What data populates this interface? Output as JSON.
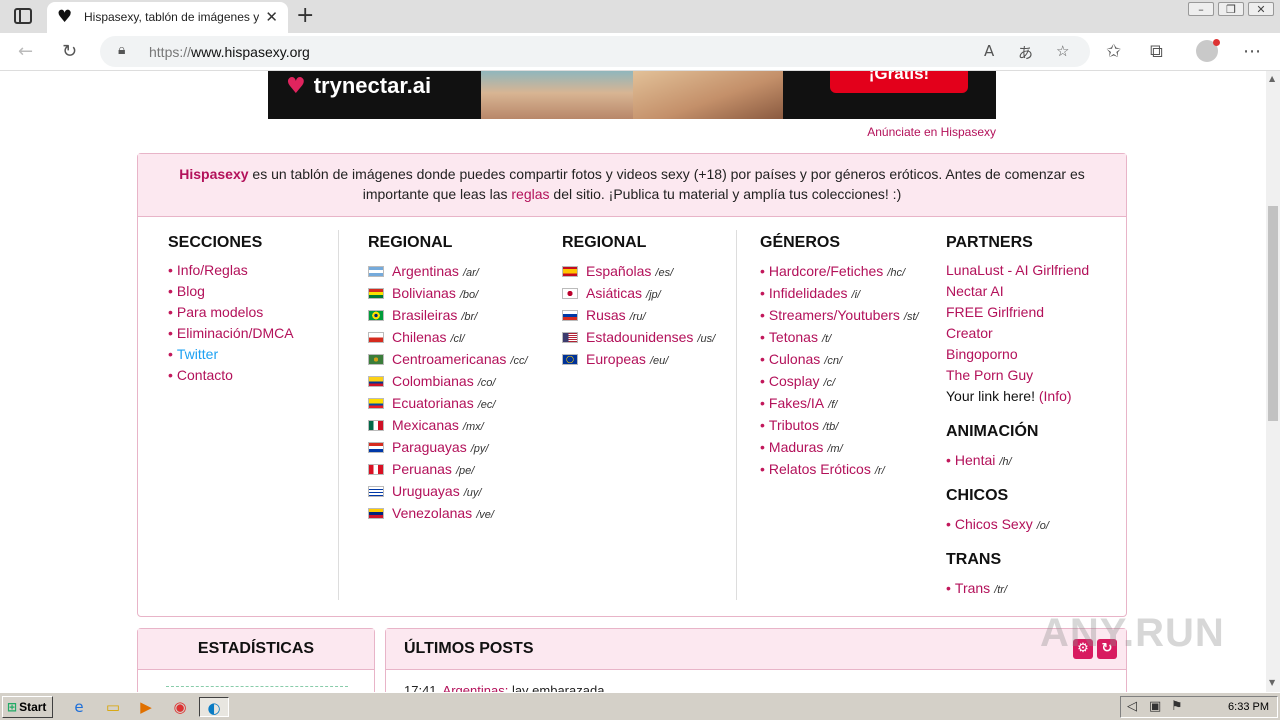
{
  "browser": {
    "tab_title": "Hispasexy, tablón de imágenes y",
    "url_scheme": "https://",
    "url_host": "www.hispasexy.org",
    "icons": [
      "tab-actions-icon",
      "heart-favicon-icon",
      "close-icon",
      "plus-icon",
      "back-icon",
      "refresh-icon",
      "lock-icon",
      "read-aloud-icon",
      "translate-icon",
      "add-favorite-icon",
      "favorites-icon",
      "collections-icon",
      "profile-icon",
      "more-icon"
    ],
    "window_buttons": [
      "–",
      "❐",
      "✕"
    ]
  },
  "ad": {
    "logo_text": "trynectar.ai",
    "cta": "¡Gratis!",
    "advertise_link": "Anúnciate en Hispasexy"
  },
  "intro": {
    "brand": "Hispasexy",
    "text_before": " es un tablón de imágenes donde puedes compartir fotos y videos sexy (+18) por países y por géneros eróticos. Antes de comenzar es importante que leas las ",
    "rules_link": "reglas",
    "text_after": " del sitio. ¡Publica tu material y amplía tus colecciones! :)"
  },
  "sections": {
    "title": "SECCIONES",
    "items": [
      {
        "label": "Info/Reglas"
      },
      {
        "label": "Blog"
      },
      {
        "label": "Para modelos"
      },
      {
        "label": "Eliminación/DMCA"
      },
      {
        "label": "Twitter"
      },
      {
        "label": "Contacto"
      }
    ]
  },
  "regional1": {
    "title": "REGIONAL",
    "items": [
      {
        "label": "Argentinas",
        "code": "/ar/"
      },
      {
        "label": "Bolivianas",
        "code": "/bo/"
      },
      {
        "label": "Brasileiras",
        "code": "/br/"
      },
      {
        "label": "Chilenas",
        "code": "/cl/"
      },
      {
        "label": "Centroamericanas",
        "code": "/cc/"
      },
      {
        "label": "Colombianas",
        "code": "/co/"
      },
      {
        "label": "Ecuatorianas",
        "code": "/ec/"
      },
      {
        "label": "Mexicanas",
        "code": "/mx/"
      },
      {
        "label": "Paraguayas",
        "code": "/py/"
      },
      {
        "label": "Peruanas",
        "code": "/pe/"
      },
      {
        "label": "Uruguayas",
        "code": "/uy/"
      },
      {
        "label": "Venezolanas",
        "code": "/ve/"
      }
    ]
  },
  "regional2": {
    "title": "REGIONAL",
    "items": [
      {
        "label": "Españolas",
        "code": "/es/"
      },
      {
        "label": "Asiáticas",
        "code": "/jp/"
      },
      {
        "label": "Rusas",
        "code": "/ru/"
      },
      {
        "label": "Estadounidenses",
        "code": "/us/"
      },
      {
        "label": "Europeas",
        "code": "/eu/"
      }
    ]
  },
  "genres": {
    "title": "GÉNEROS",
    "items": [
      {
        "label": "Hardcore/Fetiches",
        "code": "/hc/"
      },
      {
        "label": "Infidelidades",
        "code": "/i/"
      },
      {
        "label": "Streamers/Youtubers",
        "code": "/st/"
      },
      {
        "label": "Tetonas",
        "code": "/t/"
      },
      {
        "label": "Culonas",
        "code": "/cn/"
      },
      {
        "label": "Cosplay",
        "code": "/c/"
      },
      {
        "label": "Fakes/IA",
        "code": "/f/"
      },
      {
        "label": "Tributos",
        "code": "/tb/"
      },
      {
        "label": "Maduras",
        "code": "/m/"
      },
      {
        "label": "Relatos Eróticos",
        "code": "/r/"
      }
    ]
  },
  "partners": {
    "title": "PARTNERS",
    "items": [
      "LunaLust - AI Girlfriend",
      "Nectar AI",
      "FREE Girlfriend",
      "Creator",
      "Bingoporno",
      "The Porn Guy"
    ],
    "your_link": "Your link here!",
    "info": "(Info)"
  },
  "animation": {
    "title": "ANIMACIÓN",
    "label": "Hentai",
    "code": "/h/"
  },
  "boys": {
    "title": "CHICOS",
    "label": "Chicos Sexy",
    "code": "/o/"
  },
  "trans": {
    "title": "TRANS",
    "label": "Trans",
    "code": "/tr/"
  },
  "stats": {
    "title": "ESTADÍSTICAS"
  },
  "posts": {
    "title": "ÚLTIMOS POSTS",
    "first_time": "17:41",
    "first_cat": "Argentinas:",
    "first_text": "lay embarazada ..."
  },
  "watermark": "ANY.RUN",
  "taskbar": {
    "start_label": "Start",
    "clock": "6:33 PM"
  },
  "colors": {
    "accent": "#b3115a",
    "header_bg": "#fce8f0",
    "border": "#e8b4c8"
  }
}
